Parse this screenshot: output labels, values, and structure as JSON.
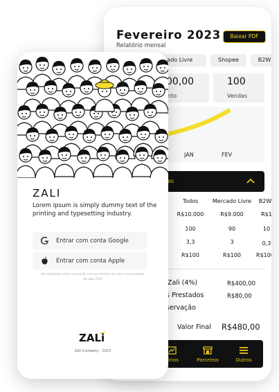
{
  "report": {
    "title": "Fevereiro 2023",
    "subtitle": "Relatório mensal",
    "pdf_button": "Baixar PDF",
    "channel_chips": [
      "rcado Livre",
      "Shopee",
      "B2W"
    ],
    "stats": [
      {
        "value": "00,00",
        "label": "nto"
      },
      {
        "value": "100",
        "label": "Vendas"
      }
    ],
    "chart_x_labels": [
      "JAN",
      "FEV"
    ],
    "chart_line_color": "#f5dd2b",
    "section_header": "es",
    "table": {
      "headers": [
        "Todos",
        "Mercado Livre",
        "B2W"
      ],
      "rows": [
        [
          "R$10.000",
          "R$9.000",
          "R$1"
        ],
        [
          "100",
          "90",
          "10"
        ],
        [
          "3,3",
          "3",
          "0,3"
        ],
        [
          "R$100",
          "R$100",
          "R$100"
        ]
      ]
    },
    "fees": [
      {
        "label": "Zali (4%)",
        "value": "R$400,00"
      },
      {
        "label": "s Prestados",
        "value": "R$80,00"
      },
      {
        "label": "rservação",
        "value": ""
      }
    ],
    "final_label": "Valor Final",
    "final_value": "R$480,00",
    "nav": [
      {
        "label": "tórios",
        "icon": "bar-chart-icon"
      },
      {
        "label": "Parceiros",
        "icon": "store-icon"
      },
      {
        "label": "Outros",
        "icon": "menu-icon"
      }
    ]
  },
  "login": {
    "brand": "ZALI",
    "description": "Lorem Ipsum is simply dummy text of the printing and typesetting industry.",
    "google_button": "Entrar com conta Google",
    "apple_button": "Entrar com conta Apple",
    "terms": "Ao continuar você concorda com os termos de uso e privacidade do app ZALI",
    "logo_text": "ZALi",
    "company": "Zali Company - 2023"
  },
  "colors": {
    "accent": "#e8c71b",
    "dark": "#111111",
    "surface": "#f1f1f1"
  }
}
